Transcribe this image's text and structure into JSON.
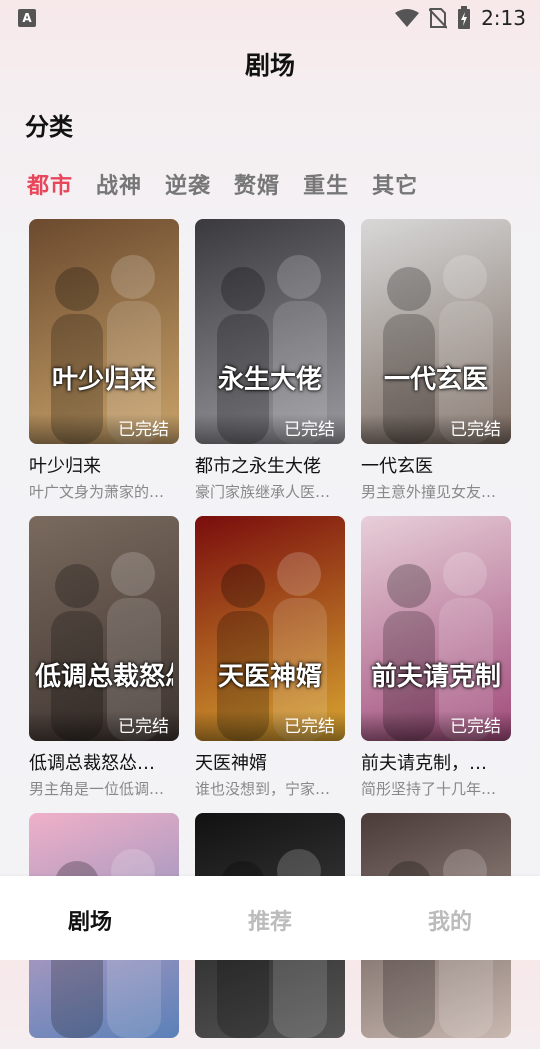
{
  "status": {
    "app_icon": "A",
    "time": "2:13"
  },
  "header": {
    "title": "剧场"
  },
  "section": {
    "title": "分类"
  },
  "tabs": [
    "都市",
    "战神",
    "逆袭",
    "赘婿",
    "重生",
    "其它"
  ],
  "cards": [
    {
      "title": "叶少归来",
      "desc": "叶广文身为萧家的…",
      "badge": "已完结",
      "poster_text": "叶少归来",
      "colors": [
        "#6b4a2e",
        "#c9a36a"
      ]
    },
    {
      "title": "都市之永生大佬",
      "desc": "豪门家族继承人医…",
      "badge": "已完结",
      "poster_text": "永生大佬",
      "colors": [
        "#3a3a3e",
        "#9a9aa0"
      ]
    },
    {
      "title": "一代玄医",
      "desc": "男主意外撞见女友…",
      "badge": "已完结",
      "poster_text": "一代玄医",
      "colors": [
        "#d8d8d8",
        "#7a6a60"
      ]
    },
    {
      "title": "低调总裁怒怂…",
      "desc": "男主角是一位低调…",
      "badge": "已完结",
      "poster_text": "低调总裁怒怂",
      "colors": [
        "#7a6a5e",
        "#3e3430"
      ]
    },
    {
      "title": "天医神婿",
      "desc": "谁也没想到，宁家…",
      "badge": "已完结",
      "poster_text": "天医神婿",
      "colors": [
        "#7a0d0d",
        "#d9a530"
      ]
    },
    {
      "title": "前夫请克制，…",
      "desc": "简彤坚持了十几年…",
      "badge": "已完结",
      "poster_text": "前夫请克制",
      "colors": [
        "#e7cfd8",
        "#a04a7a"
      ]
    },
    {
      "title": "",
      "desc": "",
      "badge": "",
      "poster_text": "",
      "colors": [
        "#f0b0c8",
        "#5a80b8"
      ]
    },
    {
      "title": "",
      "desc": "",
      "badge": "",
      "poster_text": "",
      "colors": [
        "#111111",
        "#555555"
      ]
    },
    {
      "title": "",
      "desc": "",
      "badge": "",
      "poster_text": "",
      "colors": [
        "#4a3a38",
        "#c8b8b0"
      ]
    }
  ],
  "bottom_nav": [
    "剧场",
    "推荐",
    "我的"
  ]
}
